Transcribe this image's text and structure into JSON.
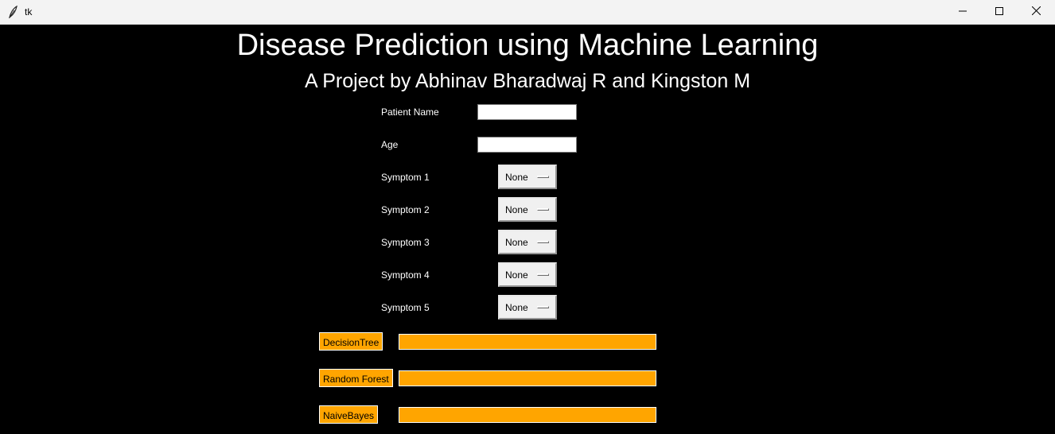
{
  "window": {
    "title": "tk"
  },
  "header": {
    "title": "Disease Prediction using Machine Learning",
    "subtitle": "A Project by Abhinav Bharadwaj R and Kingston M"
  },
  "form": {
    "patient_name_label": "Patient Name",
    "patient_name_value": "",
    "age_label": "Age",
    "age_value": "",
    "symptoms": [
      {
        "label": "Symptom 1",
        "value": "None"
      },
      {
        "label": "Symptom 2",
        "value": "None"
      },
      {
        "label": "Symptom 3",
        "value": "None"
      },
      {
        "label": "Symptom 4",
        "value": "None"
      },
      {
        "label": "Symptom 5",
        "value": "None"
      }
    ]
  },
  "predictors": [
    {
      "label": "DecisionTree",
      "result": ""
    },
    {
      "label": "Random Forest",
      "result": ""
    },
    {
      "label": "NaiveBayes",
      "result": ""
    }
  ],
  "colors": {
    "background": "#000000",
    "accent": "#ffa500",
    "text": "#ffffff"
  },
  "icons": {
    "app": "feather-icon",
    "minimize": "minimize-icon",
    "maximize": "maximize-icon",
    "close": "close-icon"
  }
}
